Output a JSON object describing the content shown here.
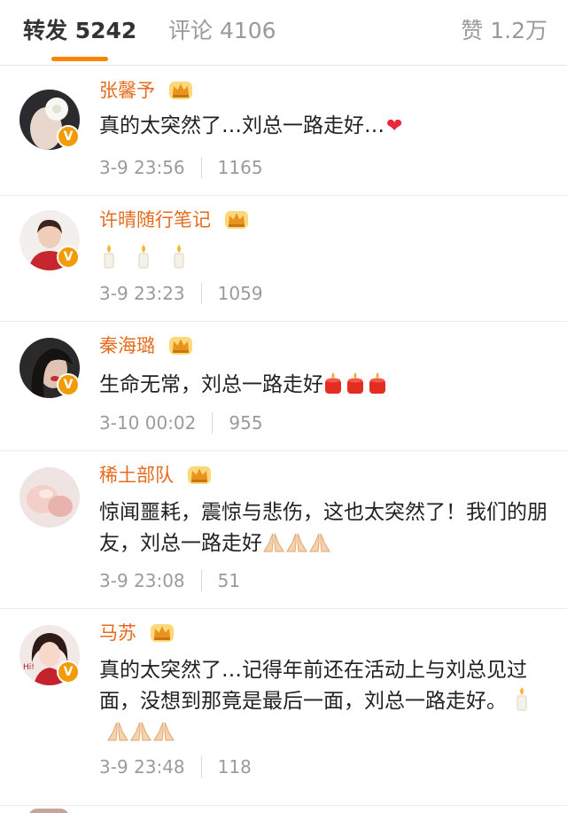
{
  "tabs": {
    "repost_label": "转发",
    "repost_count": "5242",
    "comments_label": "评论",
    "comments_count": "4106",
    "likes_label": "赞",
    "likes_count": "1.2万"
  },
  "comments": [
    {
      "user": "张馨予",
      "text": "真的太突然了…刘总一路走好…",
      "emoji": "heart",
      "time": "3-9 23:56",
      "likes": "1165"
    },
    {
      "user": "许晴随行笔记",
      "text": "",
      "emoji": "candle x3",
      "time": "3-9 23:23",
      "likes": "1059"
    },
    {
      "user": "秦海璐",
      "text": "生命无常，刘总一路走好",
      "emoji": "candle x3",
      "time": "3-10 00:02",
      "likes": "955"
    },
    {
      "user": "稀土部队",
      "text": "惊闻噩耗，震惊与悲伤，这也太突然了！我们的朋友，刘总一路走好",
      "emoji": "folded-hands x3",
      "time": "3-9 23:08",
      "likes": "51"
    },
    {
      "user": "马苏",
      "text": "真的太突然了…记得年前还在活动上与刘总见过面，没想到那竟是最后一面，刘总一路走好。",
      "emoji": "candle, folded-hands x3",
      "time": "3-9 23:48",
      "likes": "118"
    }
  ],
  "colors": {
    "accent": "#ff8200",
    "username": "#e56b1d",
    "verified_badge": "#f29b05",
    "meta_text": "#9b9b9b"
  },
  "badge_letter": "V"
}
